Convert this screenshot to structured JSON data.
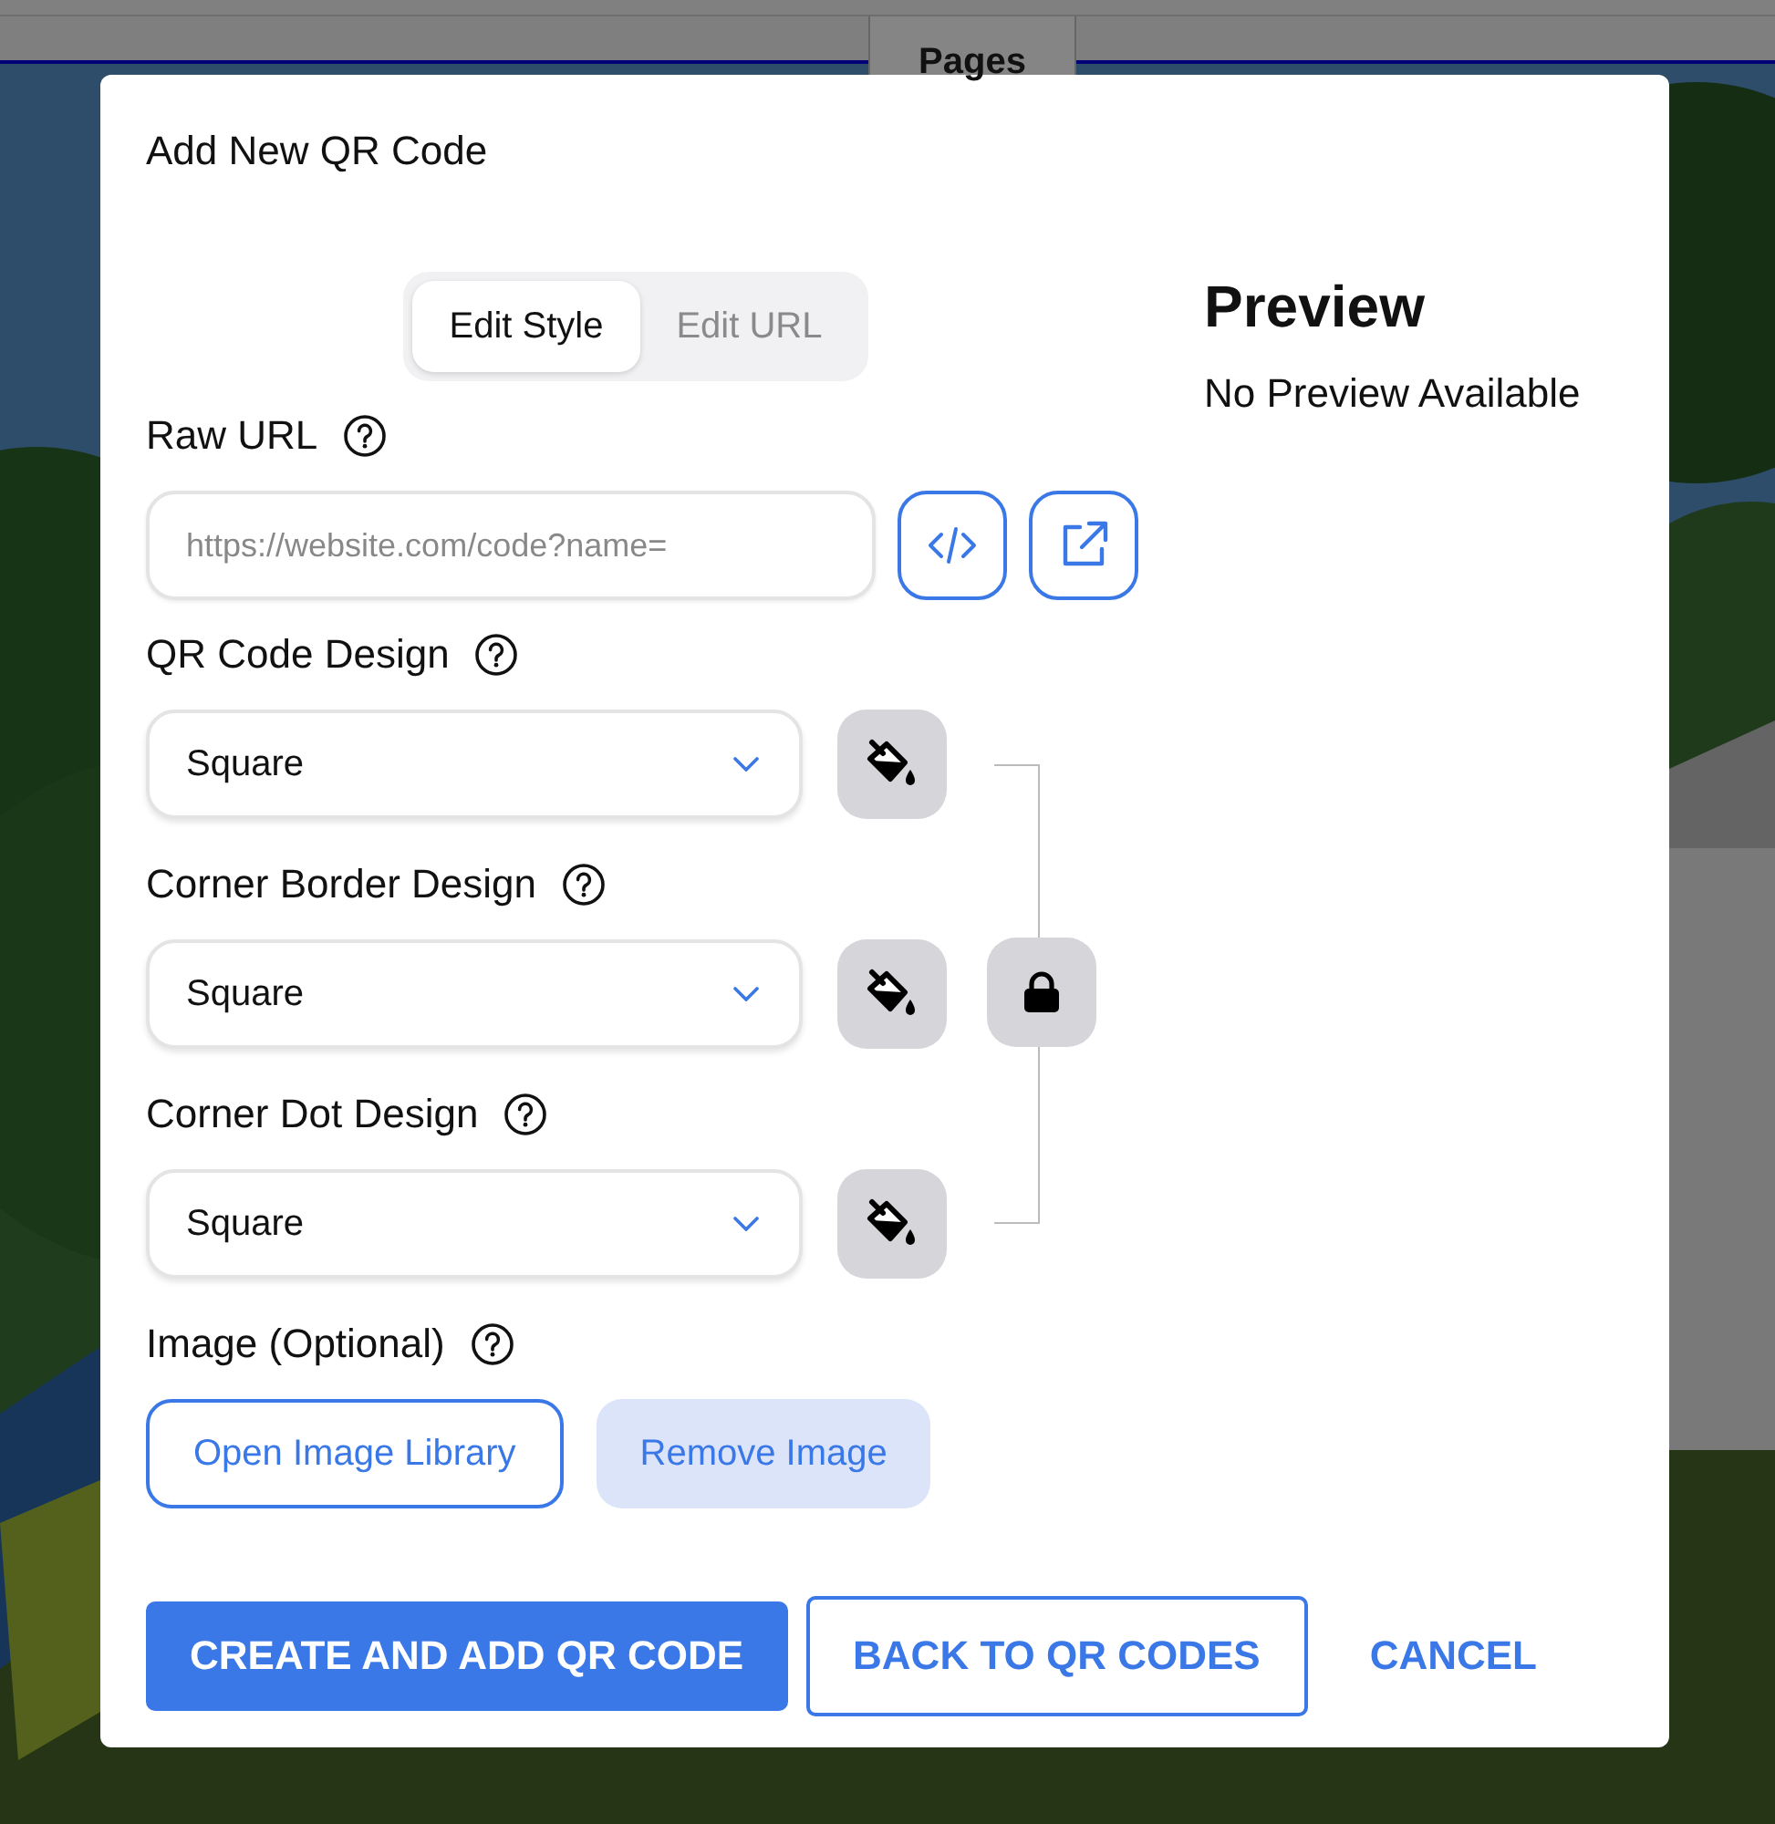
{
  "background": {
    "tab": "Pages"
  },
  "dialog": {
    "title": "Add New QR Code",
    "tabs": [
      {
        "label": "Edit Style",
        "selected": true
      },
      {
        "label": "Edit URL",
        "selected": false
      }
    ],
    "raw_url": {
      "label": "Raw URL",
      "placeholder": "https://website.com/code?name="
    },
    "designs": [
      {
        "label": "QR Code Design",
        "value": "Square"
      },
      {
        "label": "Corner Border Design",
        "value": "Square"
      },
      {
        "label": "Corner Dot Design",
        "value": "Square"
      }
    ],
    "colors_linked": true,
    "image": {
      "label": "Image (Optional)",
      "buttons": [
        {
          "label": "Open Image Library",
          "kind": "outline"
        },
        {
          "label": "Remove Image",
          "kind": "soft"
        }
      ]
    },
    "actions": [
      {
        "label": "CREATE AND ADD QR CODE",
        "kind": "primary"
      },
      {
        "label": "BACK TO QR CODES",
        "kind": "outline"
      },
      {
        "label": "CANCEL",
        "kind": "text"
      }
    ],
    "preview": {
      "title": "Preview",
      "message": "No Preview Available"
    }
  }
}
